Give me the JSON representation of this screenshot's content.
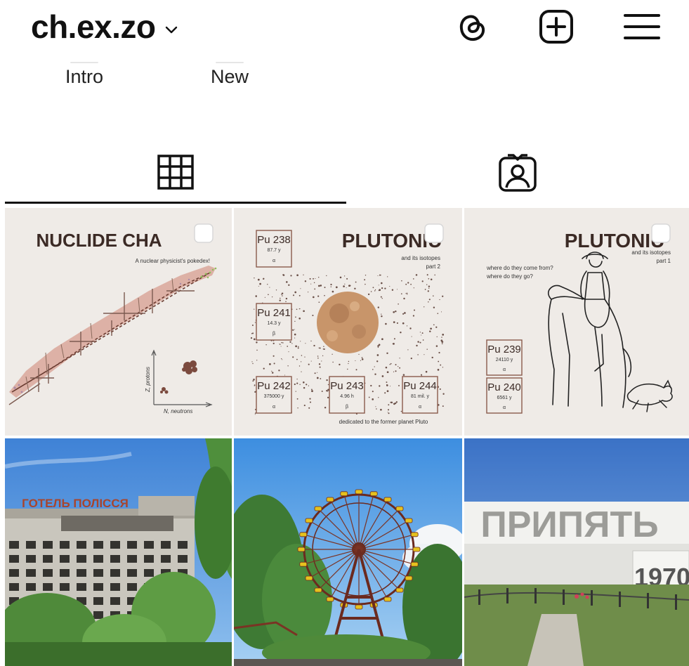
{
  "header": {
    "username": "ch.ex.zo"
  },
  "highlights": [
    {
      "label": "Intro"
    },
    {
      "label": "New"
    }
  ],
  "icons": {
    "threads": "threads-icon",
    "create": "plus-square-icon",
    "menu": "hamburger-menu-icon",
    "grid_tab": "grid-icon",
    "tagged_tab": "tagged-person-icon",
    "chevron": "chevron-down-icon",
    "multi": "multi-post-icon"
  },
  "colors": {
    "accent": "#111111",
    "post_bg": "#efebe7",
    "title": "#3b2a25",
    "tile_border": "#8a5a4c"
  },
  "posts": [
    {
      "title": "NUCLIDE CHA",
      "subtitle": "A nuclear physicist's pokedex!",
      "axis_y": "Z, protons",
      "axis_x": "N, neutrons"
    },
    {
      "title": "PLUTONIU",
      "subtitle_1": "and its isotopes",
      "subtitle_2": "part 2",
      "footer": "dedicated to the former planet Pluto",
      "isotopes": [
        {
          "name": "Pu 238",
          "life": "87.7 y",
          "decay": "α"
        },
        {
          "name": "Pu 241",
          "life": "14.3 y",
          "decay": "β"
        },
        {
          "name": "Pu 242",
          "life": "375000 y",
          "decay": "α"
        },
        {
          "name": "Pu 243",
          "life": "4.96 h",
          "decay": "β"
        },
        {
          "name": "Pu 244",
          "life": "81 mil. y",
          "decay": "α"
        }
      ]
    },
    {
      "title": "PLUTONIU",
      "subtitle_1": "and its isotopes",
      "subtitle_2": "part 1",
      "question_1": "where do they come from?",
      "question_2": "where do they go?",
      "isotopes": [
        {
          "name": "Pu 239",
          "life": "24110 y",
          "decay": "α"
        },
        {
          "name": "Pu 240",
          "life": "6561 y",
          "decay": "α"
        }
      ]
    },
    {
      "sign": "ГОТЕЛЬ ПОЛІССЯ"
    },
    {
      "caption": ""
    },
    {
      "sign": "ПРИПЯТЬ",
      "year": "1970"
    }
  ]
}
